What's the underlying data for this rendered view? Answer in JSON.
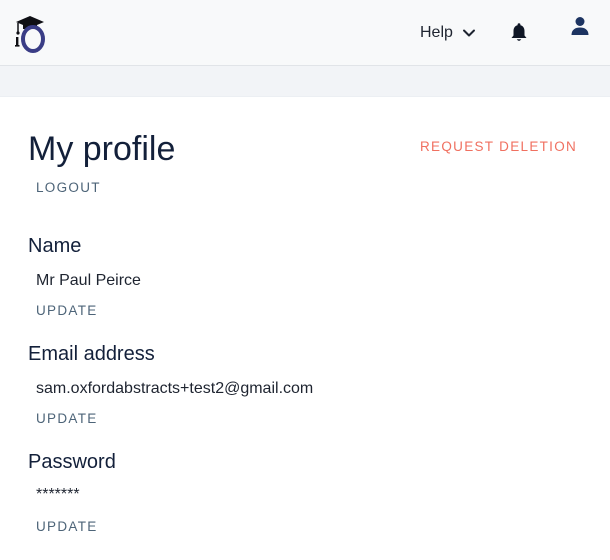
{
  "header": {
    "logo": "oxford-abstracts-logo",
    "help_label": "Help",
    "icons": [
      "chevron-down-icon",
      "bell-icon",
      "user-icon"
    ]
  },
  "profile": {
    "title": "My profile",
    "request_deletion_label": "REQUEST DELETION",
    "logout_label": "LOGOUT",
    "name": {
      "label": "Name",
      "value": "Mr Paul Peirce",
      "action": "UPDATE"
    },
    "email": {
      "label": "Email address",
      "value": "sam.oxfordabstracts+test2@gmail.com",
      "action": "UPDATE"
    },
    "password": {
      "label": "Password",
      "value": "*******",
      "action": "UPDATE"
    }
  },
  "colors": {
    "accent_danger": "#f07060",
    "link": "#4d6478",
    "text_dark": "#13203a",
    "logo_blue": "#3a3d86"
  }
}
